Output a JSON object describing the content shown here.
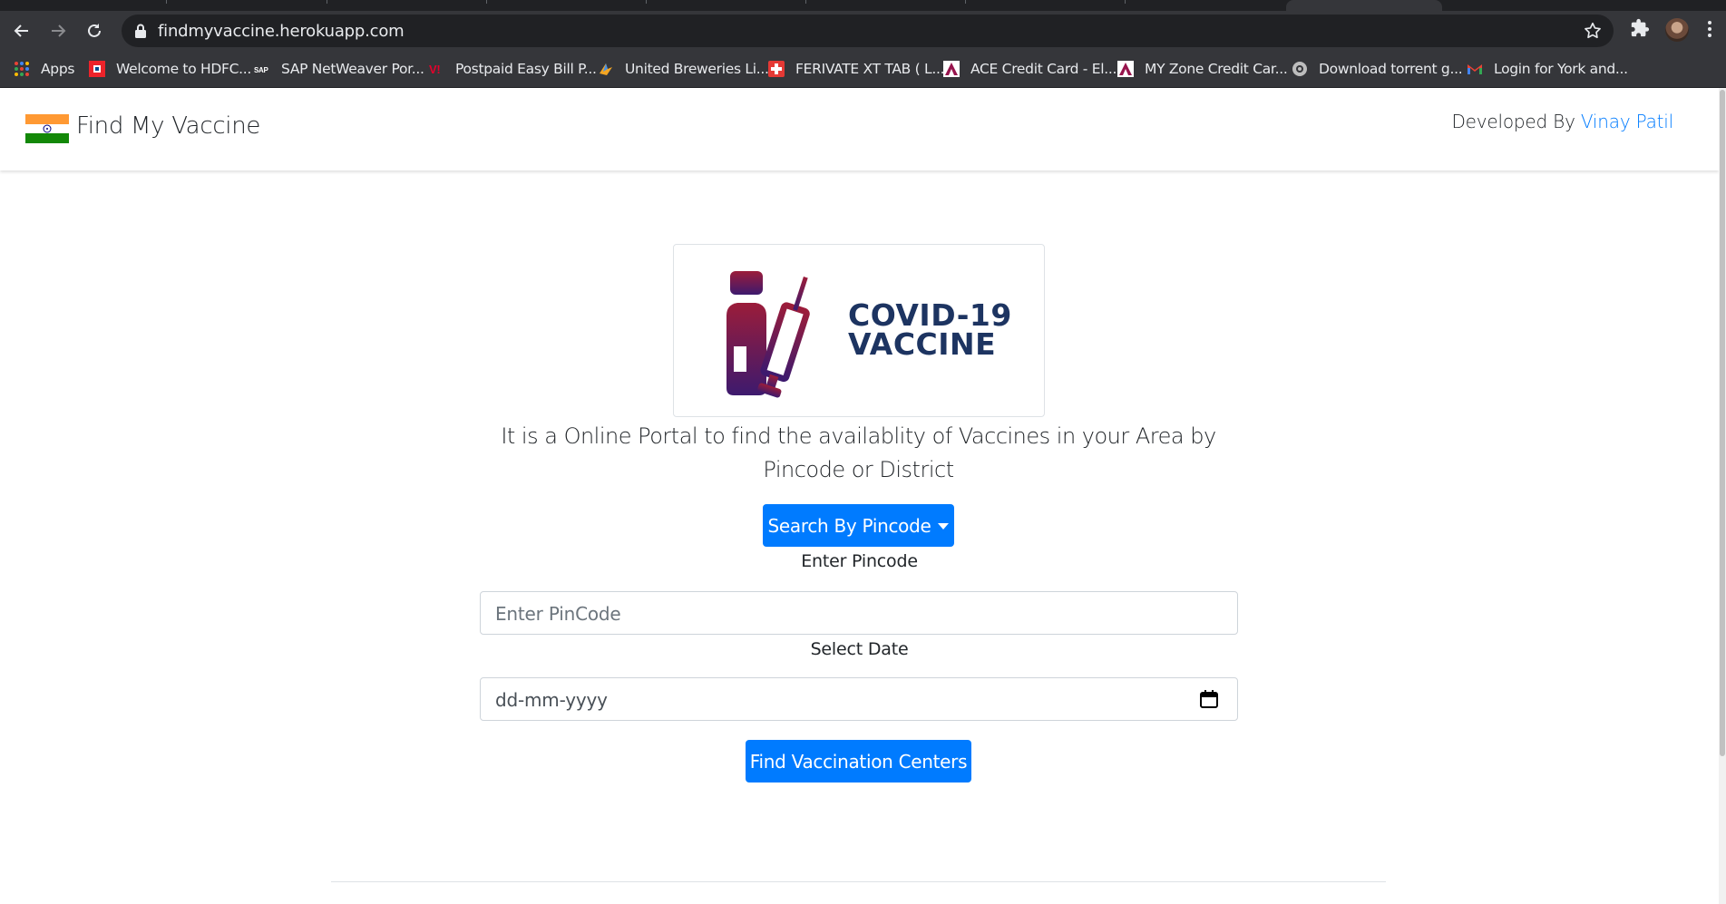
{
  "browser": {
    "url": "findmyvaccine.herokuapp.com",
    "bookmarks": [
      {
        "label": "Apps",
        "icon": "apps-grid-icon"
      },
      {
        "label": "Welcome to HDFC...",
        "icon": "hdfc-icon"
      },
      {
        "label": "SAP NetWeaver Por...",
        "icon": "sap-icon"
      },
      {
        "label": "Postpaid Easy Bill P...",
        "icon": "vi-icon"
      },
      {
        "label": "United Breweries Li...",
        "icon": "ub-icon"
      },
      {
        "label": "FERIVATE XT TAB ( L...",
        "icon": "pharmacy-cross-icon"
      },
      {
        "label": "ACE Credit Card - El...",
        "icon": "axis-bank-icon"
      },
      {
        "label": "MY Zone Credit Car...",
        "icon": "axis-bank-icon"
      },
      {
        "label": "Download torrent g...",
        "icon": "torrent-icon"
      },
      {
        "label": "Login for York and...",
        "icon": "gmail-icon"
      }
    ]
  },
  "navbar": {
    "brand": "Find My Vaccine",
    "developed_by_prefix": "Developed By",
    "developer_name": "Vinay Patil"
  },
  "main": {
    "logo_line1": "COVID-19",
    "logo_line2": "VACCINE",
    "lead_text": "It is a Online Portal to find the availablity of Vaccines in your Area by Pincode or District",
    "search_mode_button": "Search By Pincode",
    "pincode_label": "Enter Pincode",
    "pincode_placeholder": "Enter PinCode",
    "date_label": "Select Date",
    "date_placeholder": "dd-mm-yyyy",
    "submit_button": "Find Vaccination Centers"
  },
  "colors": {
    "primary": "#007bff",
    "logo_text": "#1d3461",
    "vaccine_gradient_start": "#9b1c3a",
    "vaccine_gradient_end": "#3d1a6e"
  }
}
